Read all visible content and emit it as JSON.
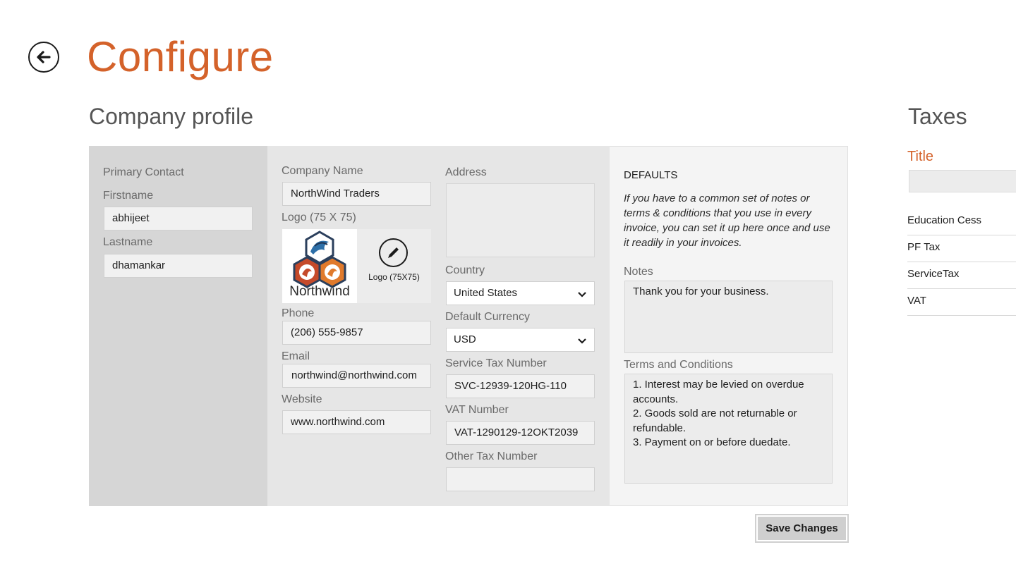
{
  "header": {
    "title": "Configure"
  },
  "company_profile": {
    "title": "Company profile",
    "primary_contact": {
      "heading": "Primary Contact",
      "firstname_label": "Firstname",
      "firstname_value": "abhijeet",
      "lastname_label": "Lastname",
      "lastname_value": "dhamankar"
    },
    "company": {
      "name_label": "Company Name",
      "name_value": "NorthWind Traders",
      "logo_label": "Logo (75 X 75)",
      "logo_brand_text": "Northwind",
      "logo_edit_label": "Logo (75X75)",
      "phone_label": "Phone",
      "phone_value": "(206) 555-9857",
      "email_label": "Email",
      "email_value": "northwind@northwind.com",
      "website_label": "Website",
      "website_value": "www.northwind.com"
    },
    "address": {
      "address_label": "Address",
      "address_value": "",
      "country_label": "Country",
      "country_value": "United States",
      "currency_label": "Default Currency",
      "currency_value": "USD",
      "service_tax_label": "Service Tax Number",
      "service_tax_value": "SVC-12939-120HG-110",
      "vat_label": "VAT Number",
      "vat_value": "VAT-1290129-12OKT2039",
      "other_tax_label": "Other Tax Number",
      "other_tax_value": ""
    },
    "defaults": {
      "heading": "DEFAULTS",
      "description": "If you have to a common set of notes or terms & conditions that you use in every invoice, you can set it up here once and use it readily in your invoices.",
      "notes_label": "Notes",
      "notes_value": "Thank you for your business.",
      "terms_label": "Terms and Conditions",
      "terms_lines": [
        "1. Interest may be levied on overdue",
        "accounts.",
        "2. Goods sold are not returnable or",
        "refundable.",
        "3. Payment on or before duedate."
      ]
    },
    "save_label": "Save Changes"
  },
  "taxes": {
    "title": "Taxes",
    "column_title": "Title",
    "input_value": "",
    "items": [
      "Education Cess",
      "PF Tax",
      "ServiceTax",
      "VAT"
    ]
  },
  "colors": {
    "accent": "#d4622a",
    "panel_dark": "#d6d6d6",
    "panel_mid": "#e6e6e6",
    "panel_light": "#f4f4f4"
  },
  "icons": {
    "back": "back-arrow-icon",
    "edit": "pencil-icon",
    "dropdown": "chevron-down-icon",
    "logo": "northwind-logo"
  }
}
